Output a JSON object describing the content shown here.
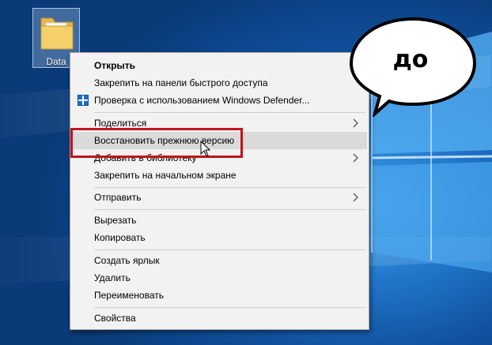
{
  "desktop": {
    "icon_label": "Data"
  },
  "menu": {
    "items": [
      {
        "label": "Открыть",
        "bold": true
      },
      {
        "label": "Закрепить на панели быстрого доступа"
      },
      {
        "label": "Проверка с использованием Windows Defender...",
        "icon": "windows-defender-icon"
      },
      {
        "label": "Поделиться",
        "submenu": true
      },
      {
        "label": "Восстановить прежнюю версию",
        "hover": true
      },
      {
        "label": "Добавить в библиотеку",
        "submenu": true
      },
      {
        "label": "Закрепить на начальном экране"
      },
      {
        "label": "Отправить",
        "submenu": true
      },
      {
        "label": "Вырезать"
      },
      {
        "label": "Копировать"
      },
      {
        "label": "Создать ярлык"
      },
      {
        "label": "Удалить"
      },
      {
        "label": "Переименовать"
      },
      {
        "label": "Свойства"
      }
    ]
  },
  "annotation": {
    "bubble_text": "до",
    "highlight_color": "#c0141b"
  },
  "colors": {
    "menu_background": "#f2f2f2",
    "hover_background": "#dadada",
    "desktop_accent": "#1f72c6"
  }
}
